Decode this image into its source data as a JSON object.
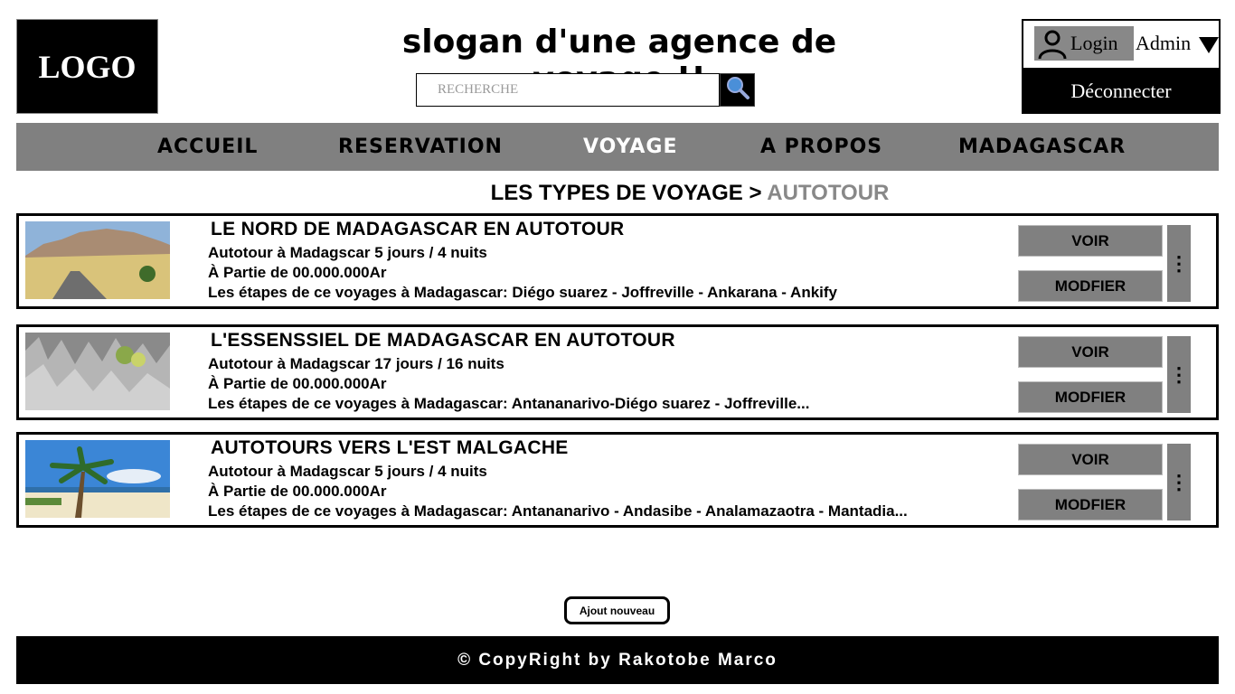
{
  "header": {
    "logo_text": "LOGO",
    "slogan": "slogan d'une agence de voyage !!",
    "search_placeholder": "RECHERCHE"
  },
  "account": {
    "login_label": "Login",
    "user_name": "Admin",
    "disconnect_label": "Déconnecter"
  },
  "nav": {
    "items": [
      {
        "label": "ACCUEIL"
      },
      {
        "label": "RESERVATION"
      },
      {
        "label": "VOYAGE"
      },
      {
        "label": "A PROPOS"
      },
      {
        "label": "MADAGASCAR"
      }
    ],
    "active": "VOYAGE"
  },
  "breadcrumb": {
    "parent": "LES TYPES DE VOYAGE",
    "separator": ">",
    "current": "AUTOTOUR"
  },
  "tours": [
    {
      "title": "LE NORD DE MADAGASCAR EN AUTOTOUR",
      "duration": "Autotour à Madagscar 5 jours / 4 nuits",
      "price": "À Partie de 00.000.000Ar",
      "stages": "Les étapes de ce voyages à Madagascar: Diégo suarez - Joffreville - Ankarana - Ankify",
      "view_label": "VOIR",
      "edit_label": "MODFIER",
      "more_label": "⋮"
    },
    {
      "title": "L'ESSENSSIEL DE MADAGASCAR EN AUTOTOUR",
      "duration": "Autotour à Madagscar 17 jours / 16 nuits",
      "price": "À Partie de 00.000.000Ar",
      "stages": "Les étapes de ce voyages à Madagascar: Antananarivo-Diégo suarez - Joffreville...",
      "view_label": "VOIR",
      "edit_label": "MODFIER",
      "more_label": "⋮"
    },
    {
      "title": "AUTOTOURS VERS L'EST MALGACHE",
      "duration": "Autotour à Madagscar 5 jours / 4 nuits",
      "price": "À Partie de 00.000.000Ar",
      "stages": "Les étapes de ce voyages à Madagascar: Antananarivo - Andasibe - Analamazaotra - Mantadia...",
      "view_label": "VOIR",
      "edit_label": "MODFIER",
      "more_label": "⋮"
    }
  ],
  "actions": {
    "add_label": "Ajout nouveau"
  },
  "footer": {
    "copyright": "© CopyRight by Rakotobe Marco"
  },
  "colors": {
    "nav_bg": "#808080",
    "button_bg": "#808080",
    "breadcrumb_current": "#888888",
    "dark": "#000000"
  }
}
